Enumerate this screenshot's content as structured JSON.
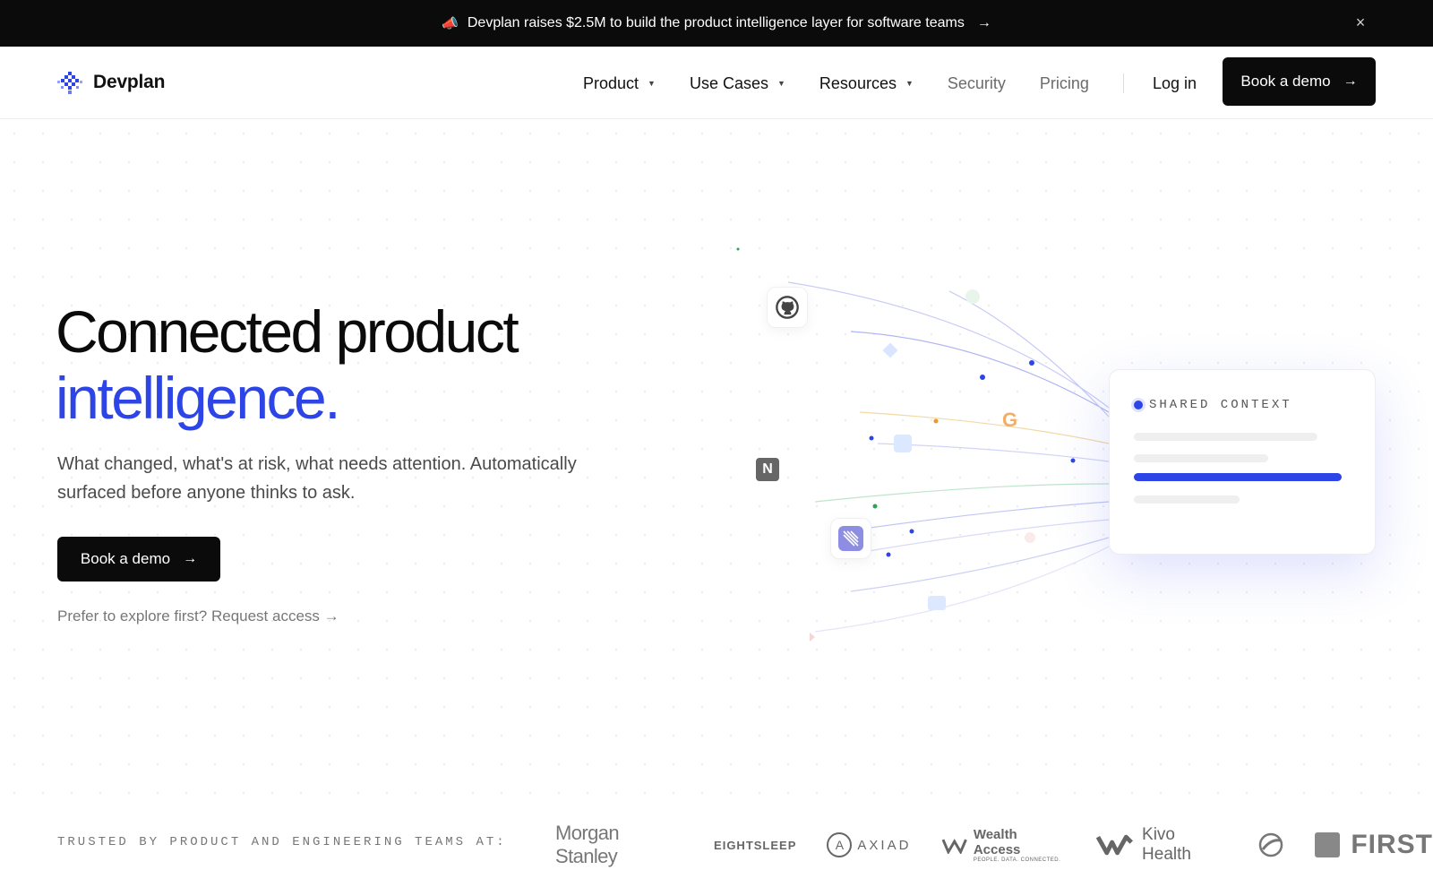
{
  "announcement": {
    "text": "Devplan raises $2.5M to build the product intelligence layer for software teams",
    "arrow": "→",
    "close": "×"
  },
  "nav": {
    "brand": "Devplan",
    "items": [
      {
        "label": "Product",
        "has_menu": true
      },
      {
        "label": "Use Cases",
        "has_menu": true
      },
      {
        "label": "Resources",
        "has_menu": true
      },
      {
        "label": "Security",
        "has_menu": false
      },
      {
        "label": "Pricing",
        "has_menu": false
      }
    ],
    "login": "Log in",
    "cta": "Book a demo",
    "caret": "▼",
    "arrow": "→"
  },
  "hero": {
    "title_line1": "Connected product",
    "title_line2": "intelligence.",
    "subtitle": "What changed, what's at risk, what needs attention. Automatically surfaced before anyone thinks to ask.",
    "cta": "Book a demo",
    "cta_arrow": "→",
    "explore": "Prefer to explore first? Request access →"
  },
  "illustration": {
    "card_label": "SHARED CONTEXT",
    "icons": [
      "github-icon",
      "notion-icon",
      "linear-icon",
      "google-icon"
    ],
    "notion_letter": "N",
    "google_letter": "G",
    "accent": "#2d45e6"
  },
  "trusted": {
    "label": "TRUSTED BY PRODUCT AND ENGINEERING TEAMS AT:",
    "brands": {
      "morgan": "Morgan Stanley",
      "eight_line1": "EIGHT",
      "eight_line2": "SLEEP",
      "axiad": "AXIAD",
      "axiad_letter": "A",
      "wealth": "Wealth Access",
      "wealth_sub": "PEOPLE. DATA. CONNECTED.",
      "kivo": "Kivo Health",
      "first": "FIRST"
    }
  },
  "colors": {
    "accent": "#2d45e6",
    "dark": "#0b0b0b"
  }
}
